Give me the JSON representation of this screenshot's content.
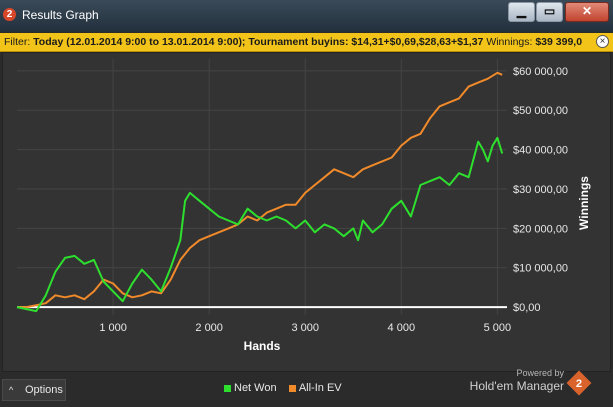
{
  "window": {
    "title": "Results Graph",
    "app_icon_text": "2",
    "minimize_glyph": "▁",
    "maximize_glyph": "▭",
    "close_glyph": "✕"
  },
  "filter": {
    "label": "Filter:",
    "date_range": "Today (12.01.2014 9:00 to 13.01.2014 9:00);",
    "buyins_label": "Tournament buyins:",
    "buyins_value": "$14,31+$0,69,$28,63+$1,37",
    "winnings_label": "Winnings:",
    "winnings_value": "$39 399,0",
    "close_glyph": "×"
  },
  "footer": {
    "options_label": "Options",
    "options_icon": "chevron-up-icon",
    "powered_by": "Powered by",
    "brand_name": "Hold'em Manager",
    "brand_logo_text": "2"
  },
  "colors": {
    "net_won": "#2ee02e",
    "all_in_ev": "#f08a2a",
    "zero_line": "#ffffff",
    "filter_bar": "#f2c41a",
    "plot_bg": "#333333"
  },
  "chart_data": {
    "type": "line",
    "xlabel": "Hands",
    "ylabel": "Winnings",
    "xlim": [
      0,
      5100
    ],
    "ylim": [
      -2000,
      63000
    ],
    "x_ticks": [
      1000,
      2000,
      3000,
      4000,
      5000
    ],
    "x_tick_labels": [
      "1 000",
      "2 000",
      "3 000",
      "4 000",
      "5 000"
    ],
    "y_ticks": [
      0,
      10000,
      20000,
      30000,
      40000,
      50000,
      60000
    ],
    "y_tick_labels": [
      "$0,00",
      "$10 000,00",
      "$20 000,00",
      "$30 000,00",
      "$40 000,00",
      "$50 000,00",
      "$60 000,00"
    ],
    "grid": true,
    "legend_position": "bottom",
    "series": [
      {
        "name": "Net Won",
        "x": [
          0,
          100,
          200,
          300,
          400,
          500,
          600,
          700,
          800,
          900,
          1000,
          1100,
          1200,
          1300,
          1400,
          1500,
          1600,
          1700,
          1750,
          1800,
          1900,
          2000,
          2100,
          2200,
          2300,
          2400,
          2500,
          2600,
          2700,
          2800,
          2900,
          3000,
          3100,
          3200,
          3300,
          3400,
          3500,
          3550,
          3600,
          3700,
          3800,
          3900,
          4000,
          4100,
          4200,
          4300,
          4400,
          4500,
          4600,
          4700,
          4800,
          4850,
          4900,
          4950,
          5000,
          5050
        ],
        "y": [
          0,
          -500,
          -1000,
          3000,
          9000,
          12500,
          13000,
          11000,
          12000,
          6500,
          4000,
          1500,
          6000,
          9500,
          7000,
          4000,
          10000,
          17000,
          27000,
          29000,
          27000,
          25000,
          23000,
          22000,
          21000,
          25000,
          23000,
          22000,
          23000,
          22000,
          20000,
          22000,
          19000,
          21000,
          20000,
          18000,
          20000,
          17000,
          22000,
          19000,
          21000,
          25000,
          27000,
          23000,
          31000,
          32000,
          33000,
          31000,
          34000,
          33000,
          42000,
          40000,
          37000,
          41000,
          43000,
          39000
        ]
      },
      {
        "name": "All-In EV",
        "x": [
          0,
          100,
          200,
          300,
          400,
          500,
          600,
          700,
          800,
          900,
          1000,
          1100,
          1200,
          1300,
          1400,
          1500,
          1600,
          1700,
          1800,
          1900,
          2000,
          2100,
          2200,
          2300,
          2400,
          2500,
          2600,
          2700,
          2800,
          2900,
          3000,
          3100,
          3200,
          3300,
          3400,
          3500,
          3600,
          3700,
          3800,
          3900,
          4000,
          4100,
          4200,
          4300,
          4400,
          4500,
          4600,
          4700,
          4800,
          4900,
          5000,
          5050
        ],
        "y": [
          0,
          0,
          500,
          1000,
          3000,
          2500,
          3000,
          2000,
          4000,
          7000,
          6000,
          3500,
          2500,
          3000,
          4000,
          3500,
          7000,
          12000,
          15000,
          17000,
          18000,
          19000,
          20000,
          21000,
          23000,
          22000,
          24000,
          25000,
          26000,
          26000,
          29000,
          31000,
          33000,
          35000,
          34000,
          33000,
          35000,
          36000,
          37000,
          38000,
          41000,
          43000,
          44000,
          48000,
          51000,
          52000,
          53000,
          56000,
          57000,
          58000,
          59500,
          59000
        ]
      }
    ]
  }
}
